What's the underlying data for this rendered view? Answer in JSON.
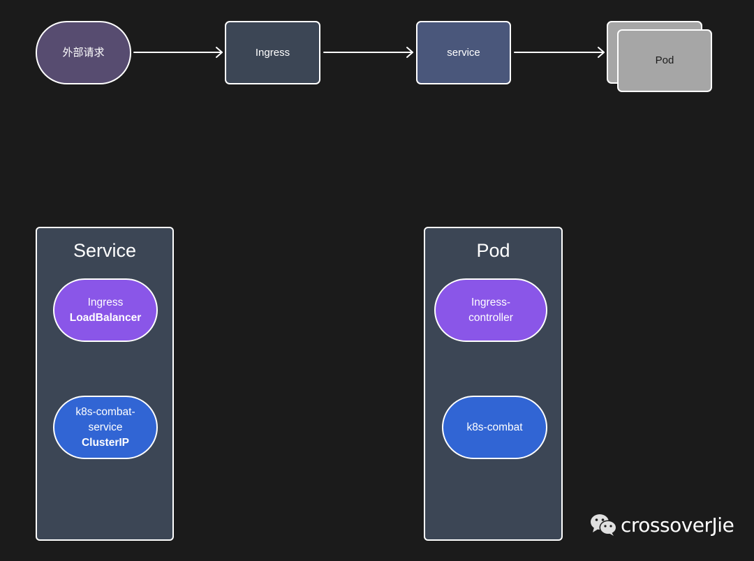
{
  "flow": {
    "external_request": "外部请求",
    "ingress": "Ingress",
    "service": "service",
    "pod": "Pod"
  },
  "service_container": {
    "title": "Service",
    "items": [
      {
        "line1": "Ingress",
        "line2_bold": "LoadBalancer"
      },
      {
        "line1": "k8s-combat-",
        "line2": "service",
        "line3_bold": "ClusterIP"
      }
    ]
  },
  "pod_container": {
    "title": "Pod",
    "items": [
      {
        "line1": "Ingress-",
        "line2": "controller"
      },
      {
        "line1": "k8s-combat"
      }
    ]
  },
  "watermark": {
    "icon": "wechat-icon",
    "text": "crossoverJie"
  },
  "colors": {
    "background": "#1b1b1b",
    "external_request": "#574c70",
    "ingress": "#3c4655",
    "service": "#4a577b",
    "pod": "#a6a6a6",
    "container": "#3c4655",
    "purple_node": "#8a56e8",
    "blue_node": "#3165d4"
  }
}
